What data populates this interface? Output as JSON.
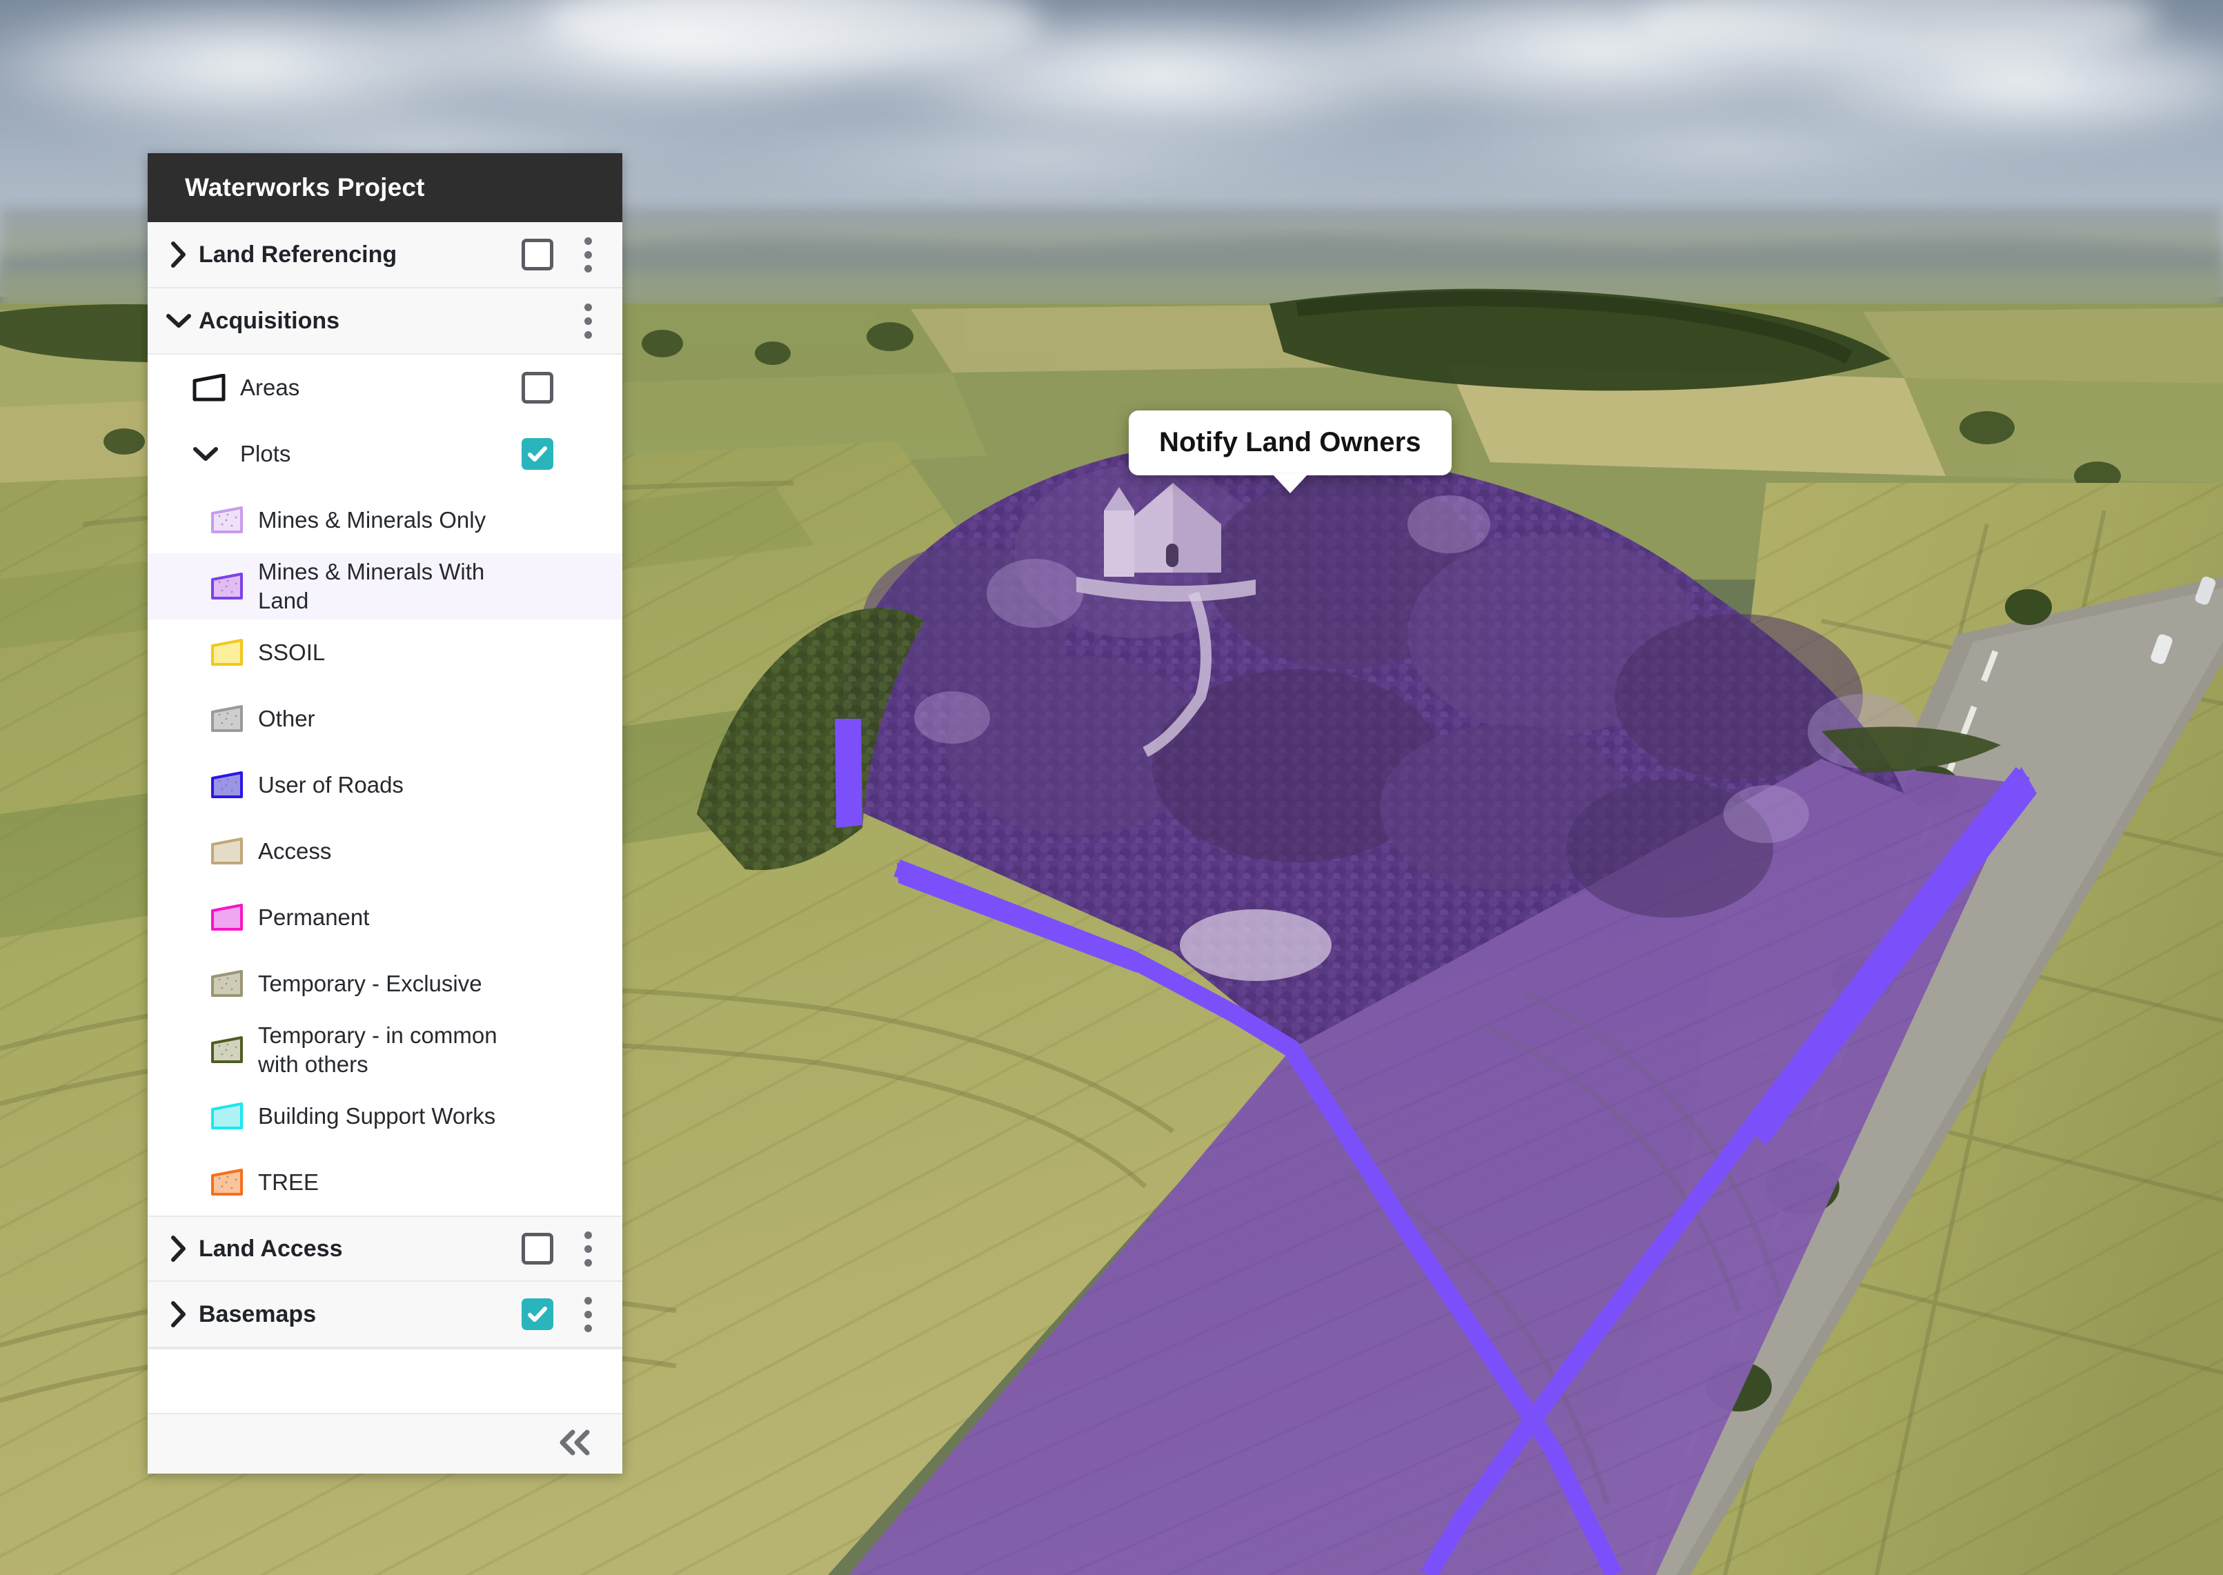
{
  "panel": {
    "title": "Waterworks Project",
    "collapse_icon": "double-chevron-left-icon",
    "groups": [
      {
        "id": "land-referencing",
        "label": "Land Referencing",
        "chevron": "chevron-right-icon",
        "checked": false,
        "has_checkbox": true,
        "has_kebab": true
      },
      {
        "id": "acquisitions",
        "label": "Acquisitions",
        "chevron": "chevron-down-icon",
        "checked": false,
        "has_checkbox": false,
        "has_kebab": true
      },
      {
        "id": "land-access",
        "label": "Land Access",
        "chevron": "chevron-right-icon",
        "checked": false,
        "has_checkbox": true,
        "has_kebab": true
      },
      {
        "id": "basemaps",
        "label": "Basemaps",
        "chevron": "chevron-right-icon",
        "checked": true,
        "has_checkbox": true,
        "has_kebab": true
      }
    ],
    "acquisitions_children": [
      {
        "id": "areas",
        "label": "Areas",
        "icon": "polygon-outline-icon",
        "checked": false,
        "has_checkbox": true
      },
      {
        "id": "plots",
        "label": "Plots",
        "icon": "chevron-down-icon",
        "checked": true,
        "has_checkbox": true
      }
    ],
    "plots": [
      {
        "id": "mines-minerals-only",
        "label": "Mines & Minerals Only",
        "fill": "#EFE2F8",
        "stroke": "#C89BEE",
        "dotted": true,
        "selected": false
      },
      {
        "id": "mines-minerals-with-land",
        "label": "Mines & Minerals With Land",
        "fill": "#E2BDF5",
        "stroke": "#7B42E8",
        "dotted": true,
        "selected": true
      },
      {
        "id": "ssoil",
        "label": "SSOIL",
        "fill": "#FDEF9C",
        "stroke": "#F2C81B",
        "dotted": false,
        "selected": false
      },
      {
        "id": "other",
        "label": "Other",
        "fill": "#CECECE",
        "stroke": "#9A9A9A",
        "dotted": true,
        "selected": false
      },
      {
        "id": "user-of-roads",
        "label": "User of Roads",
        "fill": "#9B95E8",
        "stroke": "#2B16E8",
        "dotted": true,
        "selected": false
      },
      {
        "id": "access",
        "label": "Access",
        "fill": "#E5DCC8",
        "stroke": "#C0A878",
        "dotted": false,
        "selected": false
      },
      {
        "id": "permanent",
        "label": "Permanent",
        "fill": "#F0A6F0",
        "stroke": "#F716C7",
        "dotted": false,
        "selected": false
      },
      {
        "id": "temporary-exclusive",
        "label": "Temporary - Exclusive",
        "fill": "#CFCCB6",
        "stroke": "#9A9577",
        "dotted": true,
        "selected": false
      },
      {
        "id": "temporary-in-common",
        "label": "Temporary - in common with others",
        "fill": "#D3D3BD",
        "stroke": "#4E5C22",
        "dotted": true,
        "selected": false
      },
      {
        "id": "building-support-works",
        "label": "Building Support Works",
        "fill": "#AFF2F4",
        "stroke": "#18E8F0",
        "dotted": false,
        "selected": false
      },
      {
        "id": "tree",
        "label": "TREE",
        "fill": "#FCC49A",
        "stroke": "#F4701B",
        "dotted": true,
        "selected": false
      }
    ]
  },
  "map": {
    "callout_label": "Notify Land Owners",
    "boundary_color": "#7B50FA",
    "highlight_overlay_color": "#6C3CA8"
  }
}
